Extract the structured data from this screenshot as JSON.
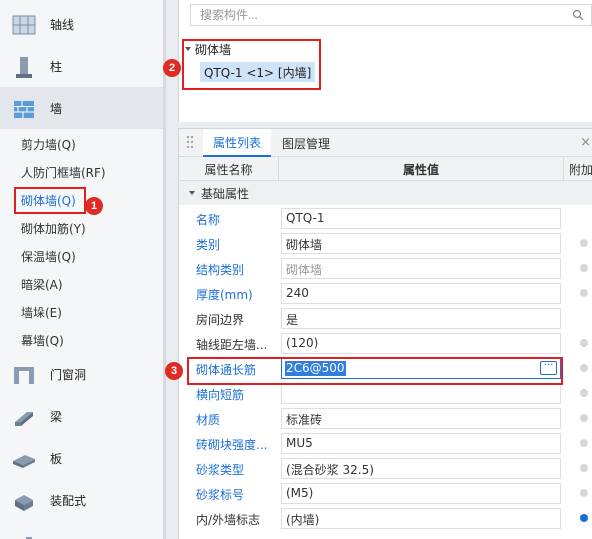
{
  "nav": {
    "categories": [
      {
        "label": "轴线",
        "icon": "grid-axis-icon"
      },
      {
        "label": "柱",
        "icon": "column-icon"
      },
      {
        "label": "墙",
        "icon": "wall-brick-icon"
      }
    ],
    "wall_items": [
      {
        "label": "剪力墙(Q)"
      },
      {
        "label": "人防门框墙(RF)"
      },
      {
        "label": "砌体墙(Q)"
      },
      {
        "label": "砌体加筋(Y)"
      },
      {
        "label": "保温墙(Q)"
      },
      {
        "label": "暗梁(A)"
      },
      {
        "label": "墙垛(E)"
      },
      {
        "label": "幕墙(Q)"
      }
    ],
    "more_categories": [
      {
        "label": "门窗洞",
        "icon": "door-window-icon"
      },
      {
        "label": "梁",
        "icon": "beam-icon"
      },
      {
        "label": "板",
        "icon": "slab-icon"
      },
      {
        "label": "装配式",
        "icon": "prefab-icon"
      },
      {
        "label": "",
        "icon": "stair-icon"
      }
    ]
  },
  "search": {
    "placeholder": "搜索构件..."
  },
  "tree": {
    "root": "砌体墙",
    "item": "QTQ-1 <1> [内墙]"
  },
  "tabs": {
    "properties": "属性列表",
    "layers": "图层管理",
    "close": "×"
  },
  "columns": {
    "name": "属性名称",
    "value": "属性值",
    "extra": "附加"
  },
  "group": "基础属性",
  "properties": [
    {
      "name": "名称",
      "value": "QTQ-1"
    },
    {
      "name": "类别",
      "value": "砌体墙"
    },
    {
      "name": "结构类别",
      "value": "砌体墙"
    },
    {
      "name": "厚度(mm)",
      "value": "240"
    },
    {
      "name": "房间边界",
      "value": "是"
    },
    {
      "name": "轴线距左墙...",
      "value": "(120)"
    },
    {
      "name": "砌体通长筋",
      "value": "2C6@500"
    },
    {
      "name": "横向短筋",
      "value": ""
    },
    {
      "name": "材质",
      "value": "标准砖"
    },
    {
      "name": "砖砌块强度...",
      "value": "MU5"
    },
    {
      "name": "砂浆类型",
      "value": "(混合砂浆  32.5)"
    },
    {
      "name": "砂浆标号",
      "value": "(M5)"
    },
    {
      "name": "内/外墙标志",
      "value": "(内墙)"
    }
  ],
  "edit_button": "···",
  "badges": [
    "1",
    "2",
    "3"
  ],
  "colors": {
    "accent": "#1a6fd8",
    "highlight": "#e02020",
    "selection": "#cfe3f7"
  }
}
